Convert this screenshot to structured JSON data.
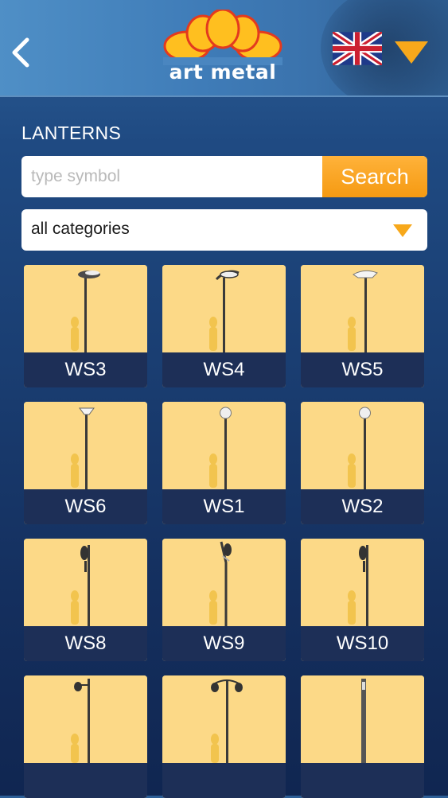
{
  "header": {
    "logo_text": "art metal",
    "colors": {
      "logo_petals": "#ffbf1f",
      "logo_outline": "#e33a1e",
      "accent": "#f59a12"
    }
  },
  "section_title": "LANTERNS",
  "search": {
    "placeholder": "type symbol",
    "value": "",
    "button_label": "Search"
  },
  "category": {
    "selected": "all categories"
  },
  "products": [
    {
      "label": "WS3",
      "type": "flat-head"
    },
    {
      "label": "WS4",
      "type": "flat-head"
    },
    {
      "label": "WS5",
      "type": "flat-head-light"
    },
    {
      "label": "WS6",
      "type": "bowl-top"
    },
    {
      "label": "WS1",
      "type": "globe-top"
    },
    {
      "label": "WS2",
      "type": "globe-top"
    },
    {
      "label": "WS8",
      "type": "hook-lantern"
    },
    {
      "label": "WS9",
      "type": "hook-lantern-arm"
    },
    {
      "label": "WS10",
      "type": "hook-lantern"
    },
    {
      "label": "",
      "type": "side-lantern"
    },
    {
      "label": "",
      "type": "double-lantern"
    },
    {
      "label": "",
      "type": "bollard-post"
    }
  ]
}
